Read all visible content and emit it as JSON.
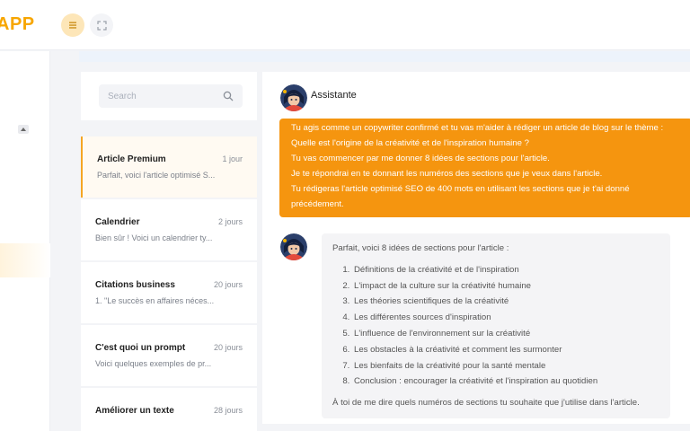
{
  "header": {
    "logo_text": "APP",
    "menu_icon": "hamburger-icon",
    "expand_icon": "fullscreen-icon"
  },
  "search": {
    "placeholder": "Search"
  },
  "conversations": [
    {
      "title": "Article Premium",
      "time": "1 jour",
      "preview": "Parfait, voici l'article optimisé S..."
    },
    {
      "title": "Calendrier",
      "time": "2 jours",
      "preview": "Bien sûr ! Voici un calendrier ty..."
    },
    {
      "title": "Citations business",
      "time": "20 jours",
      "preview": "1. \"Le succès en affaires néces..."
    },
    {
      "title": "C'est quoi un prompt",
      "time": "20 jours",
      "preview": "Voici quelques exemples de pr..."
    },
    {
      "title": "Améliorer un texte",
      "time": "28 jours",
      "preview": ""
    }
  ],
  "chat": {
    "assistant_name": "Assistante",
    "user_message": [
      "Tu agis comme un copywriter confirmé et tu vas m'aider à rédiger un article de blog sur le thème :",
      "Quelle est l'origine de la créativité et de l'inspiration humaine ?",
      "Tu vas commencer par me donner 8 idées de sections pour l'article.",
      "Je te répondrai en te donnant les numéros des sections que je veux dans l'article.",
      "Tu rédigeras l'article optimisé SEO de 400 mots en utilisant les sections que je t'ai donné",
      "précédement."
    ],
    "assistant_reply": {
      "intro": "Parfait, voici 8 idées de sections pour l'article :",
      "items": [
        "Définitions de la créativité et de l'inspiration",
        "L'impact de la culture sur la créativité humaine",
        "Les théories scientifiques de la créativité",
        "Les différentes sources d'inspiration",
        "L'influence de l'environnement sur la créativité",
        "Les obstacles à la créativité et comment les surmonter",
        "Les bienfaits de la créativité pour la santé mentale",
        "Conclusion : encourager la créativité et l'inspiration au quotidien"
      ],
      "outro": "À toi de me dire quels numéros de sections tu souhaite que j'utilise dans l'article."
    }
  },
  "colors": {
    "accent": "#f5950f",
    "logo": "#f7a600"
  }
}
